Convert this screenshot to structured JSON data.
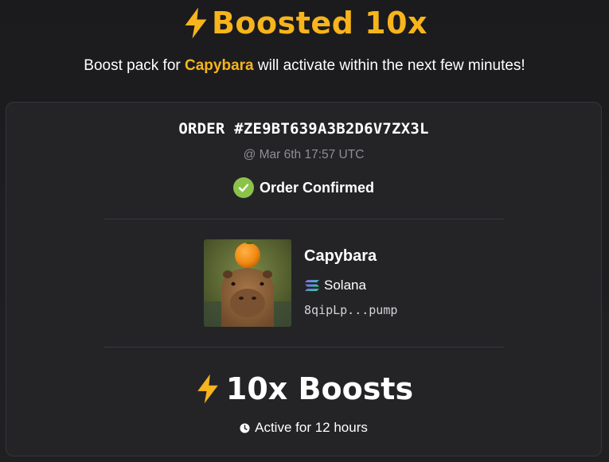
{
  "header": {
    "title": "Boosted 10x",
    "title_icon": "lightning-bolt-icon",
    "subtitle_prefix": "Boost pack for ",
    "subtitle_token": "Capybara",
    "subtitle_suffix": " will activate within the next few minutes!"
  },
  "order": {
    "id": "ORDER #ZE9BT639A3B2D6V7ZX3L",
    "timestamp": "@ Mar 6th 17:57 UTC",
    "status": "Order Confirmed",
    "status_icon": "check-circle-icon"
  },
  "token": {
    "name": "Capybara",
    "chain": "Solana",
    "chain_icon": "solana-logo-icon",
    "address": "8qipLp...pump"
  },
  "boost": {
    "label": "10x Boosts",
    "icon": "lightning-bolt-icon",
    "duration": "Active for 12 hours",
    "duration_icon": "clock-icon"
  },
  "colors": {
    "accent": "#f7b41c",
    "success": "#8bc34a",
    "background": "#1d1d20",
    "card": "#242427",
    "muted": "#8e8e94"
  }
}
